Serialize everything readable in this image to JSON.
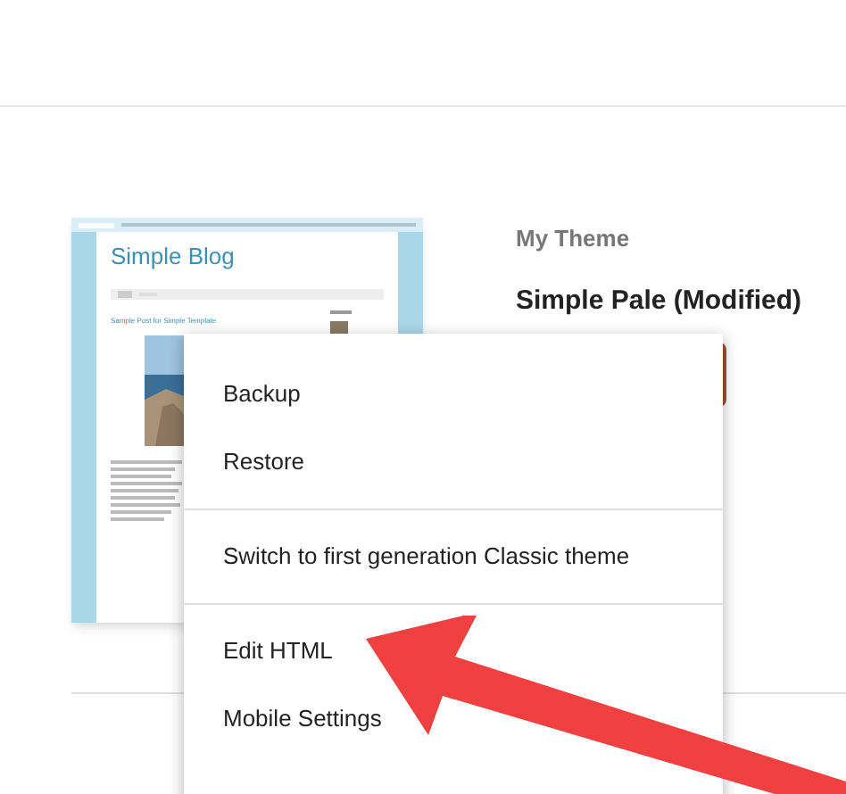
{
  "theme_preview": {
    "blog_title": "Simple Blog",
    "post_title": "Sample Post for Simple Template"
  },
  "theme": {
    "label": "My Theme",
    "name": "Simple Pale (Modified)"
  },
  "menu": {
    "groups": [
      {
        "items": [
          "Backup",
          "Restore"
        ]
      },
      {
        "items": [
          "Switch to first generation Classic theme"
        ]
      },
      {
        "items": [
          "Edit HTML",
          "Mobile Settings"
        ]
      }
    ]
  }
}
